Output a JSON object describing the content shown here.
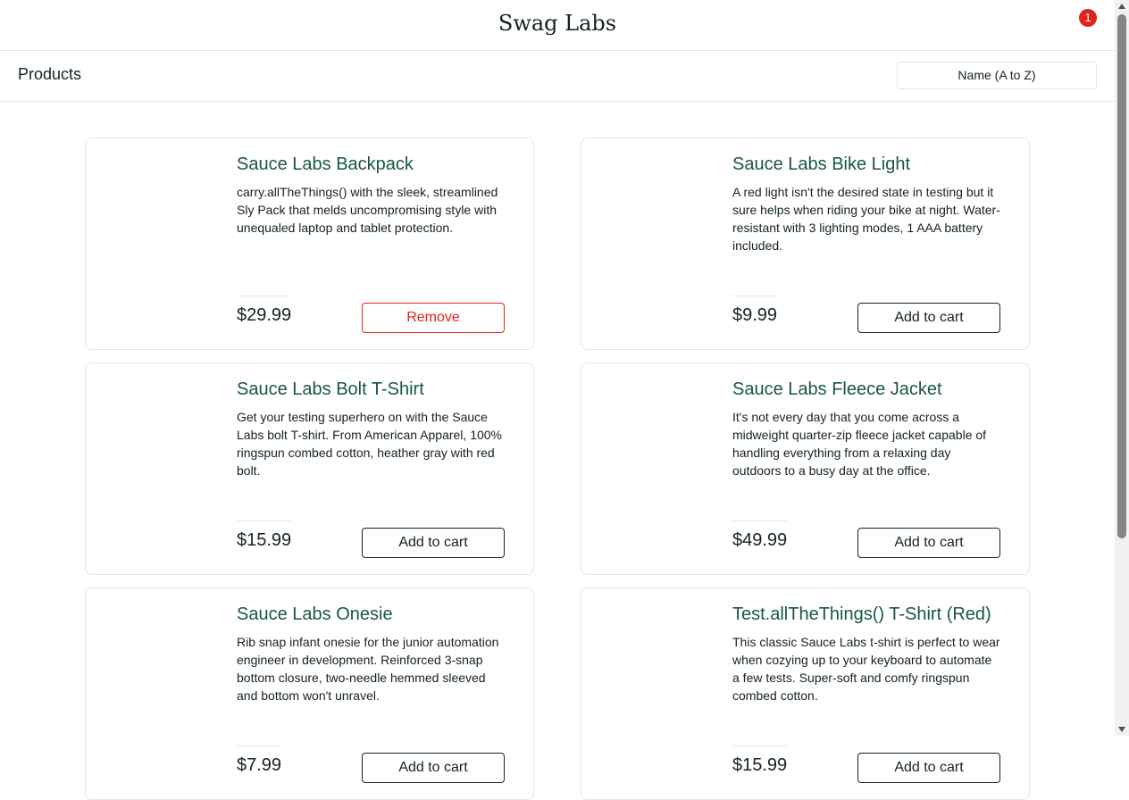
{
  "header": {
    "logo": "Swag Labs",
    "cart_count": "1"
  },
  "secondary": {
    "title": "Products",
    "sort_selected": "Name (A to Z)"
  },
  "products": [
    {
      "name": "Sauce Labs Backpack",
      "description": "carry.allTheThings() with the sleek, streamlined Sly Pack that melds uncompromising style with unequaled laptop and tablet protection.",
      "price": "$29.99",
      "button": "Remove"
    },
    {
      "name": "Sauce Labs Bike Light",
      "description": "A red light isn't the desired state in testing but it sure helps when riding your bike at night. Water-resistant with 3 lighting modes, 1 AAA battery included.",
      "price": "$9.99",
      "button": "Add to cart"
    },
    {
      "name": "Sauce Labs Bolt T-Shirt",
      "description": "Get your testing superhero on with the Sauce Labs bolt T-shirt. From American Apparel, 100% ringspun combed cotton, heather gray with red bolt.",
      "price": "$15.99",
      "button": "Add to cart"
    },
    {
      "name": "Sauce Labs Fleece Jacket",
      "description": "It's not every day that you come across a midweight quarter-zip fleece jacket capable of handling everything from a relaxing day outdoors to a busy day at the office.",
      "price": "$49.99",
      "button": "Add to cart"
    },
    {
      "name": "Sauce Labs Onesie",
      "description": "Rib snap infant onesie for the junior automation engineer in development. Reinforced 3-snap bottom closure, two-needle hemmed sleeved and bottom won't unravel.",
      "price": "$7.99",
      "button": "Add to cart"
    },
    {
      "name": "Test.allTheThings() T-Shirt (Red)",
      "description": "This classic Sauce Labs t-shirt is perfect to wear when cozying up to your keyboard to automate a few tests. Super-soft and comfy ringspun combed cotton.",
      "price": "$15.99",
      "button": "Add to cart"
    }
  ],
  "colors": {
    "accent_name": "#18583a",
    "remove": "#e2231a",
    "badge": "#e2231a"
  }
}
